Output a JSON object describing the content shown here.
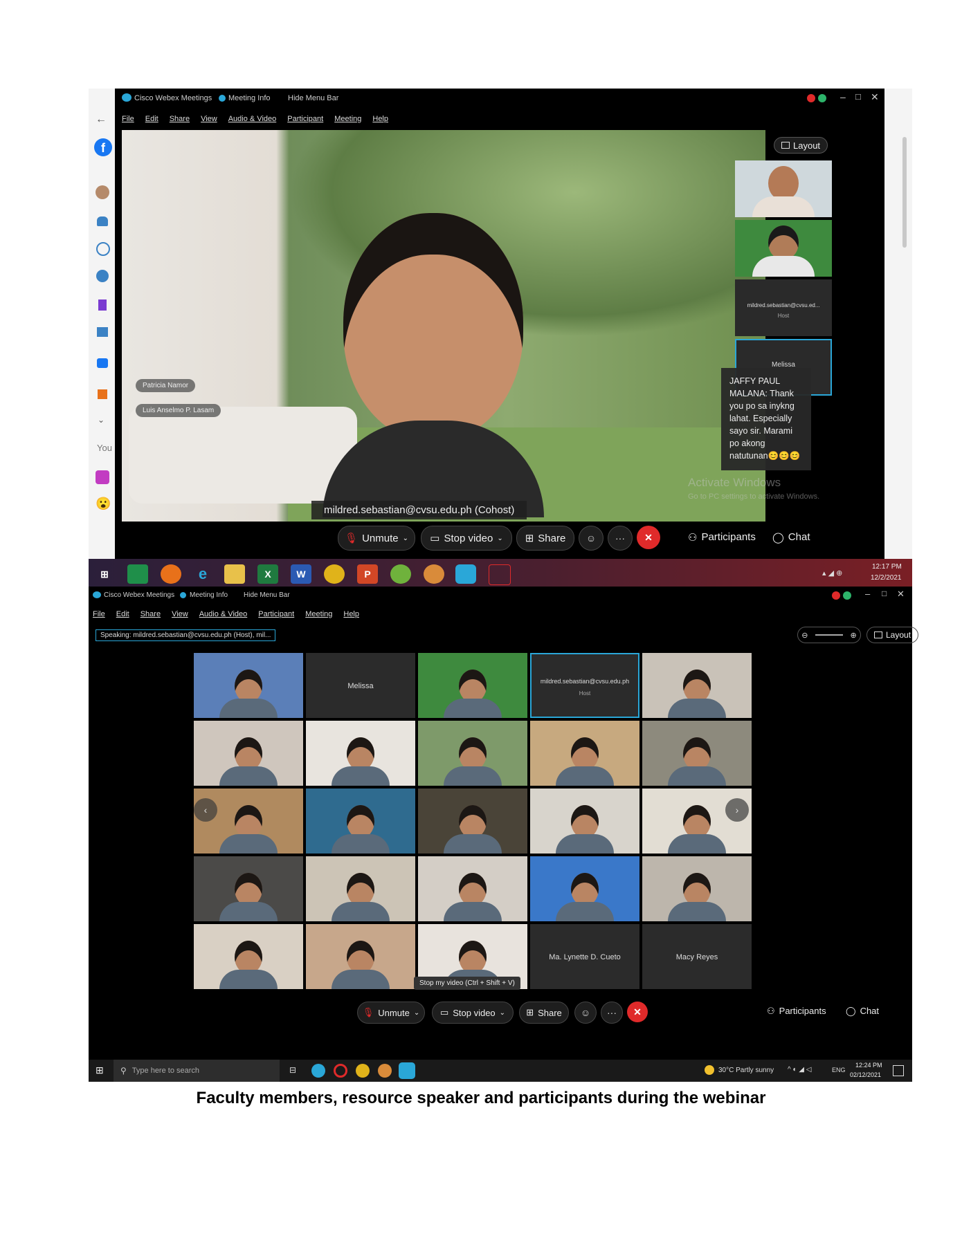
{
  "top": {
    "app_title": "Cisco Webex Meetings",
    "meeting_info": "Meeting Info",
    "hide_menu": "Hide Menu Bar",
    "menu": [
      "File",
      "Edit",
      "Share",
      "View",
      "Audio & Video",
      "Participant",
      "Meeting",
      "Help"
    ],
    "layout_label": "Layout",
    "speaker_label": "mildred.sebastian@cvsu.edu.ph (Cohost)",
    "name_tags": [
      "Patricia Namor",
      "Luis Anselmo P. Lasam"
    ],
    "sidebar_tiles": [
      {
        "name": ""
      },
      {
        "name": ""
      },
      {
        "name": "mildred.sebastian@cvsu.ed...",
        "sub": "Host"
      },
      {
        "name": "Melissa"
      }
    ],
    "chat_popup": "JAFFY PAUL MALANA: Thank you po sa inykng lahat. Especially sayo sir. Marami po akong natutunan😊😊😊",
    "watermark_title": "Activate Windows",
    "watermark_sub": "Go to PC settings to activate Windows.",
    "controls": {
      "unmute": "Unmute",
      "stop_video": "Stop video",
      "share": "Share",
      "participants": "Participants",
      "chat": "Chat"
    },
    "left_sidebar_text": "You",
    "taskbar": {
      "time": "12:17 PM",
      "date": "12/2/2021",
      "apps": [
        "X",
        "W",
        "P"
      ]
    }
  },
  "bottom": {
    "app_title": "Cisco Webex Meetings",
    "meeting_info": "Meeting Info",
    "hide_menu": "Hide Menu Bar",
    "menu": [
      "File",
      "Edit",
      "Share",
      "View",
      "Audio & Video",
      "Participant",
      "Meeting",
      "Help"
    ],
    "speaking": "Speaking: mildred.sebastian@cvsu.edu.ph (Host), mil...",
    "layout_label": "Layout",
    "tiles": [
      {
        "name": "",
        "bg": "#5b7fb8"
      },
      {
        "name": "Melissa",
        "bg": "#2b2b2b"
      },
      {
        "name": "",
        "bg": "#3e8a3e"
      },
      {
        "name": "mildred.sebastian@cvsu.edu.ph",
        "sub": "Host",
        "bg": "#2b2b2b"
      },
      {
        "name": "",
        "bg": "#c9c2b8"
      },
      {
        "name": "",
        "bg": "#cfc6bd"
      },
      {
        "name": "",
        "bg": "#e8e4de"
      },
      {
        "name": "",
        "bg": "#7e9a6a"
      },
      {
        "name": "",
        "bg": "#c7a97f"
      },
      {
        "name": "",
        "bg": "#8d8a7d"
      },
      {
        "name": "",
        "bg": "#b08a5f"
      },
      {
        "name": "",
        "bg": "#2f6b8f"
      },
      {
        "name": "",
        "bg": "#4a4438"
      },
      {
        "name": "",
        "bg": "#d8d4cc"
      },
      {
        "name": "",
        "bg": "#e2ddd3"
      },
      {
        "name": "",
        "bg": "#4b4a48"
      },
      {
        "name": "",
        "bg": "#ccc4b6"
      },
      {
        "name": "",
        "bg": "#d4cec6"
      },
      {
        "name": "",
        "bg": "#3a78c9"
      },
      {
        "name": "",
        "bg": "#bdb6ac"
      },
      {
        "name": "",
        "bg": "#d9d0c4"
      },
      {
        "name": "",
        "bg": "#c7a78b"
      },
      {
        "name": "",
        "bg": "#e8e3dd"
      },
      {
        "name": "Ma. Lynette D. Cueto",
        "bg": "#2b2b2b"
      },
      {
        "name": "Macy Reyes",
        "bg": "#2b2b2b"
      }
    ],
    "tooltip": "Stop my video (Ctrl + Shift + V)",
    "controls": {
      "unmute": "Unmute",
      "stop_video": "Stop video",
      "share": "Share",
      "participants": "Participants",
      "chat": "Chat"
    },
    "taskbar": {
      "search": "Type here to search",
      "weather": "30°C Partly sunny",
      "lang": "ENG",
      "time": "12:24 PM",
      "date": "02/12/2021"
    }
  },
  "caption": "Faculty members, resource speaker and participants during the webinar",
  "colors": {
    "accent": "#2aa7d8",
    "end_call": "#e02a2a",
    "taskbar": "#2b1f3a"
  }
}
